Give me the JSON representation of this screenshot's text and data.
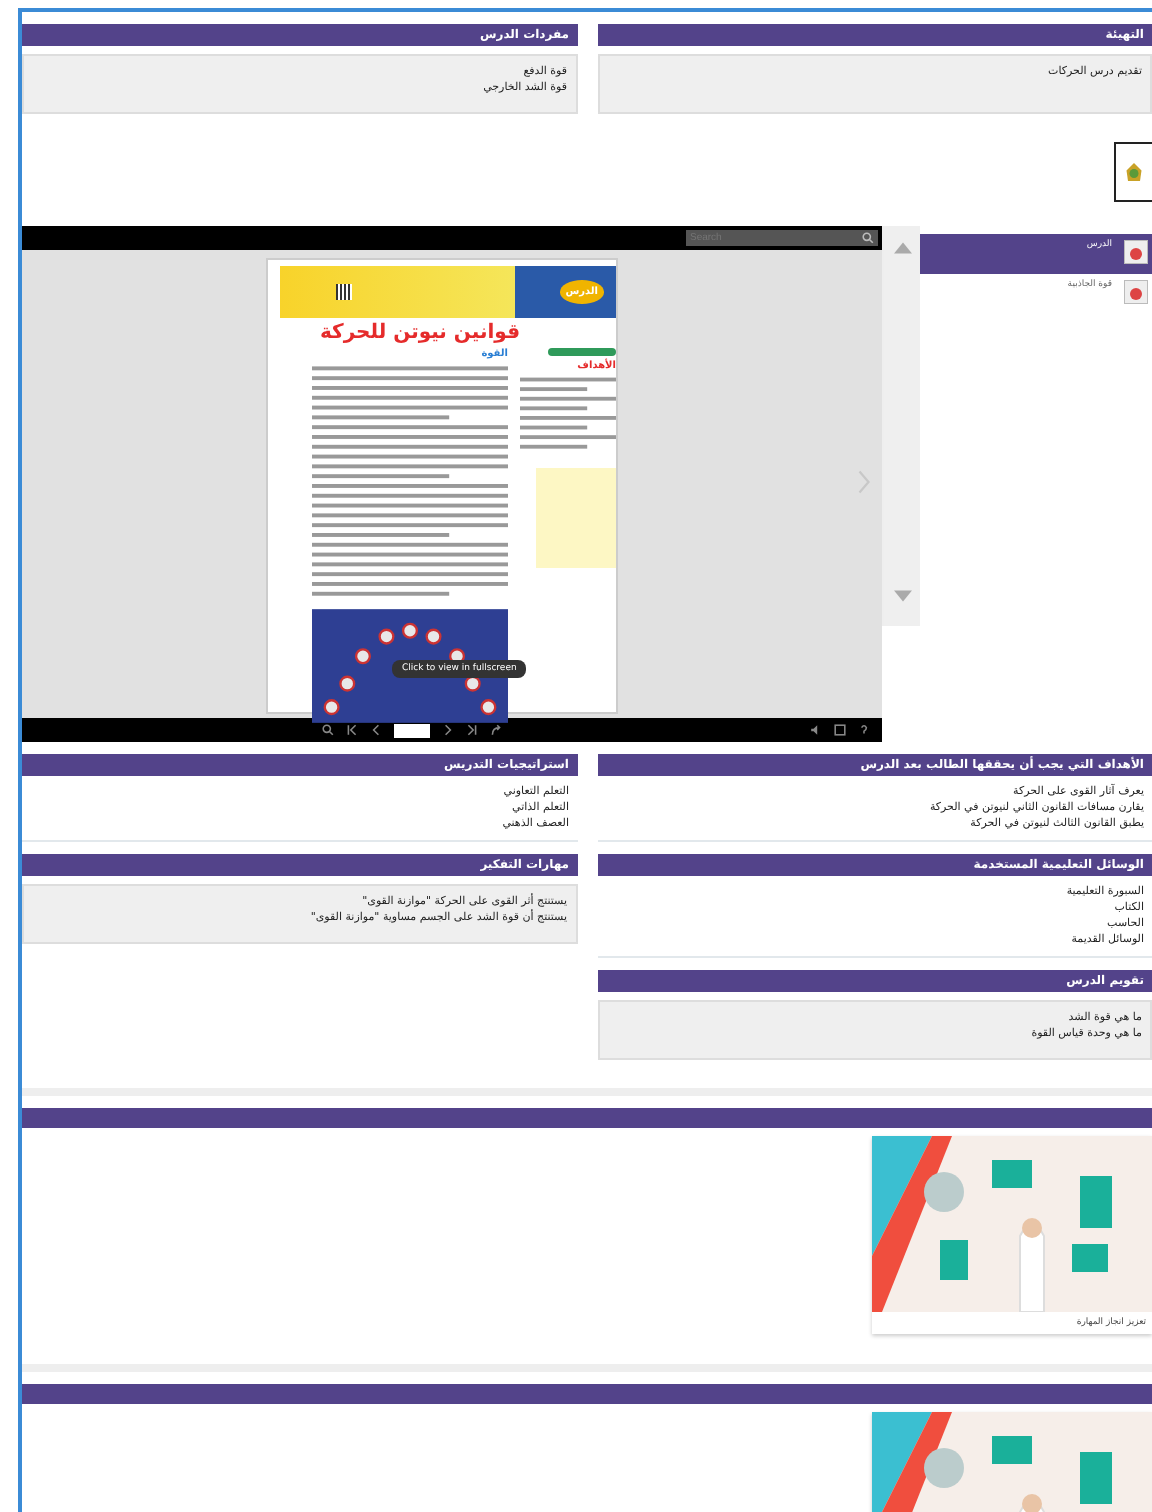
{
  "top_panels": [
    {
      "title": "التهيئة",
      "lines": [
        "تقديم درس الحركات"
      ],
      "boxed": true,
      "attachment": true
    },
    {
      "title": "مفردات الدرس",
      "lines": [
        "قوة الدفع",
        "قوة الشد الخارجي"
      ],
      "boxed": true,
      "attachment": false
    }
  ],
  "viewer": {
    "search_placeholder": "Search",
    "lesson_badge": "الدرس",
    "book_title": "قوانين نيوتن للحركة",
    "section_heading": "القوة",
    "objectives_heading": "الأهداف",
    "tooltip": "Click to view in fullscreen",
    "thumbnails": [
      {
        "label": "الدرس",
        "selected": true
      },
      {
        "label": "قوة الجاذبية",
        "selected": false
      }
    ]
  },
  "left_panels": [
    {
      "title": "استراتيجيات التدريس",
      "lines": [
        "التعلم التعاوني",
        "التعلم الذاتي",
        "العصف الذهني"
      ],
      "boxed": false
    },
    {
      "title": "مهارات التفكير",
      "lines": [
        "يستنتج أثر القوى على الحركة \"موازنة القوى\"",
        "يستنتج أن قوة الشد على الجسم مساوية \"موازنة القوى\""
      ],
      "boxed": true
    }
  ],
  "right_panels": [
    {
      "title": "الأهداف التي يجب أن يحققها الطالب بعد الدرس",
      "lines": [
        "يعرف آثار القوى على الحركة",
        "يقارن مسافات القانون الثاني لنيوتن في الحركة",
        "يطبق القانون الثالث لنيوتن في الحركة"
      ],
      "boxed": false
    },
    {
      "title": "الوسائل التعليمية المستخدمة",
      "lines": [
        "السبورة التعليمية",
        "الكتاب",
        "الحاسب",
        "الوسائل القديمة"
      ],
      "boxed": false
    },
    {
      "title": "تقويم الدرس",
      "lines": [
        "ما هي قوة الشد",
        "ما هي وحدة قياس القوة"
      ],
      "boxed": true
    }
  ],
  "media": [
    {
      "kind": "illustration",
      "caption": "تعزيز انجاز المهارة"
    },
    {
      "kind": "illustration"
    }
  ]
}
